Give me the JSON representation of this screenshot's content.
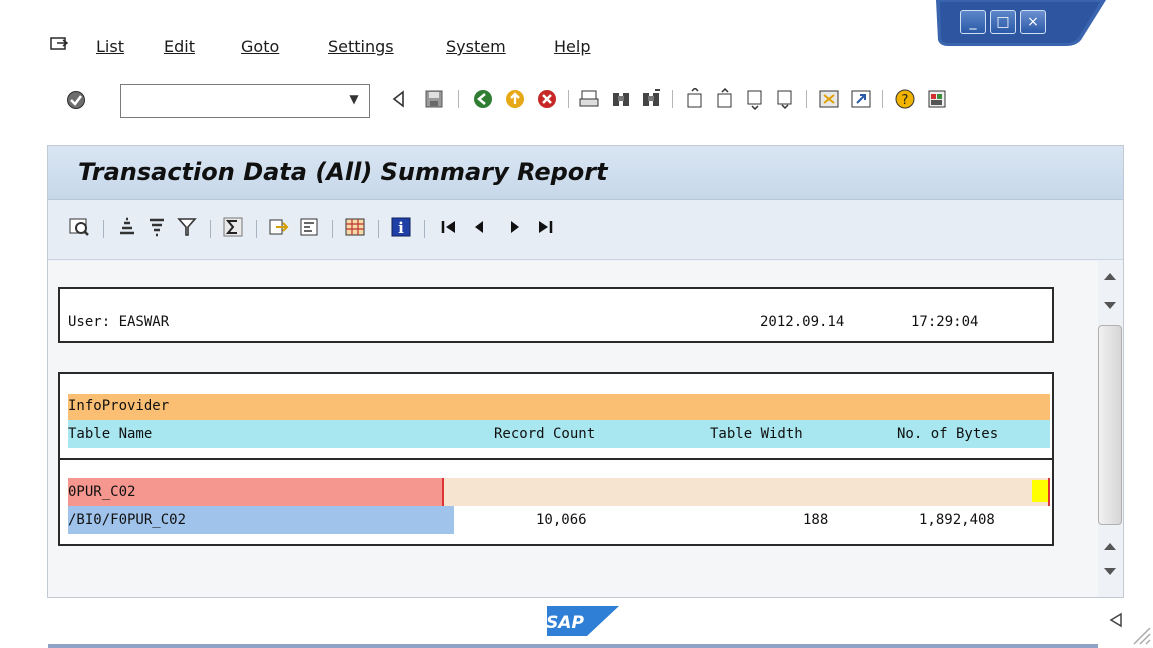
{
  "menu": {
    "items": [
      {
        "label": "List"
      },
      {
        "label": "Edit"
      },
      {
        "label": "Goto"
      },
      {
        "label": "Settings"
      },
      {
        "label": "System"
      },
      {
        "label": "Help"
      }
    ]
  },
  "window_controls": {
    "minimize": "_",
    "maximize": "□",
    "close": "×"
  },
  "command_field": {
    "value": "",
    "placeholder": ""
  },
  "report": {
    "title": "Transaction Data (All) Summary Report",
    "header": {
      "user_label": "User: EASWAR",
      "date": "2012.09.14",
      "time": "17:29:04"
    },
    "table": {
      "group_header": "InfoProvider",
      "columns": [
        "Table Name",
        "Record Count",
        "Table Width",
        "No. of Bytes"
      ],
      "provider": "0PUR_C02",
      "rows": [
        {
          "table_name": "/BI0/F0PUR_C02",
          "record_count": "10,066",
          "table_width": "188",
          "bytes": "1,892,408"
        }
      ]
    }
  },
  "colors": {
    "group_header_bg": "#fbbf73",
    "column_header_bg": "#a8e6f0",
    "provider_bg": "#f5968f",
    "provider_fill": "#f6e4d0",
    "table_name_bg": "#9fc3eb",
    "marker_yellow": "#ffff00"
  },
  "footer": {
    "logo_text": "SAP"
  }
}
